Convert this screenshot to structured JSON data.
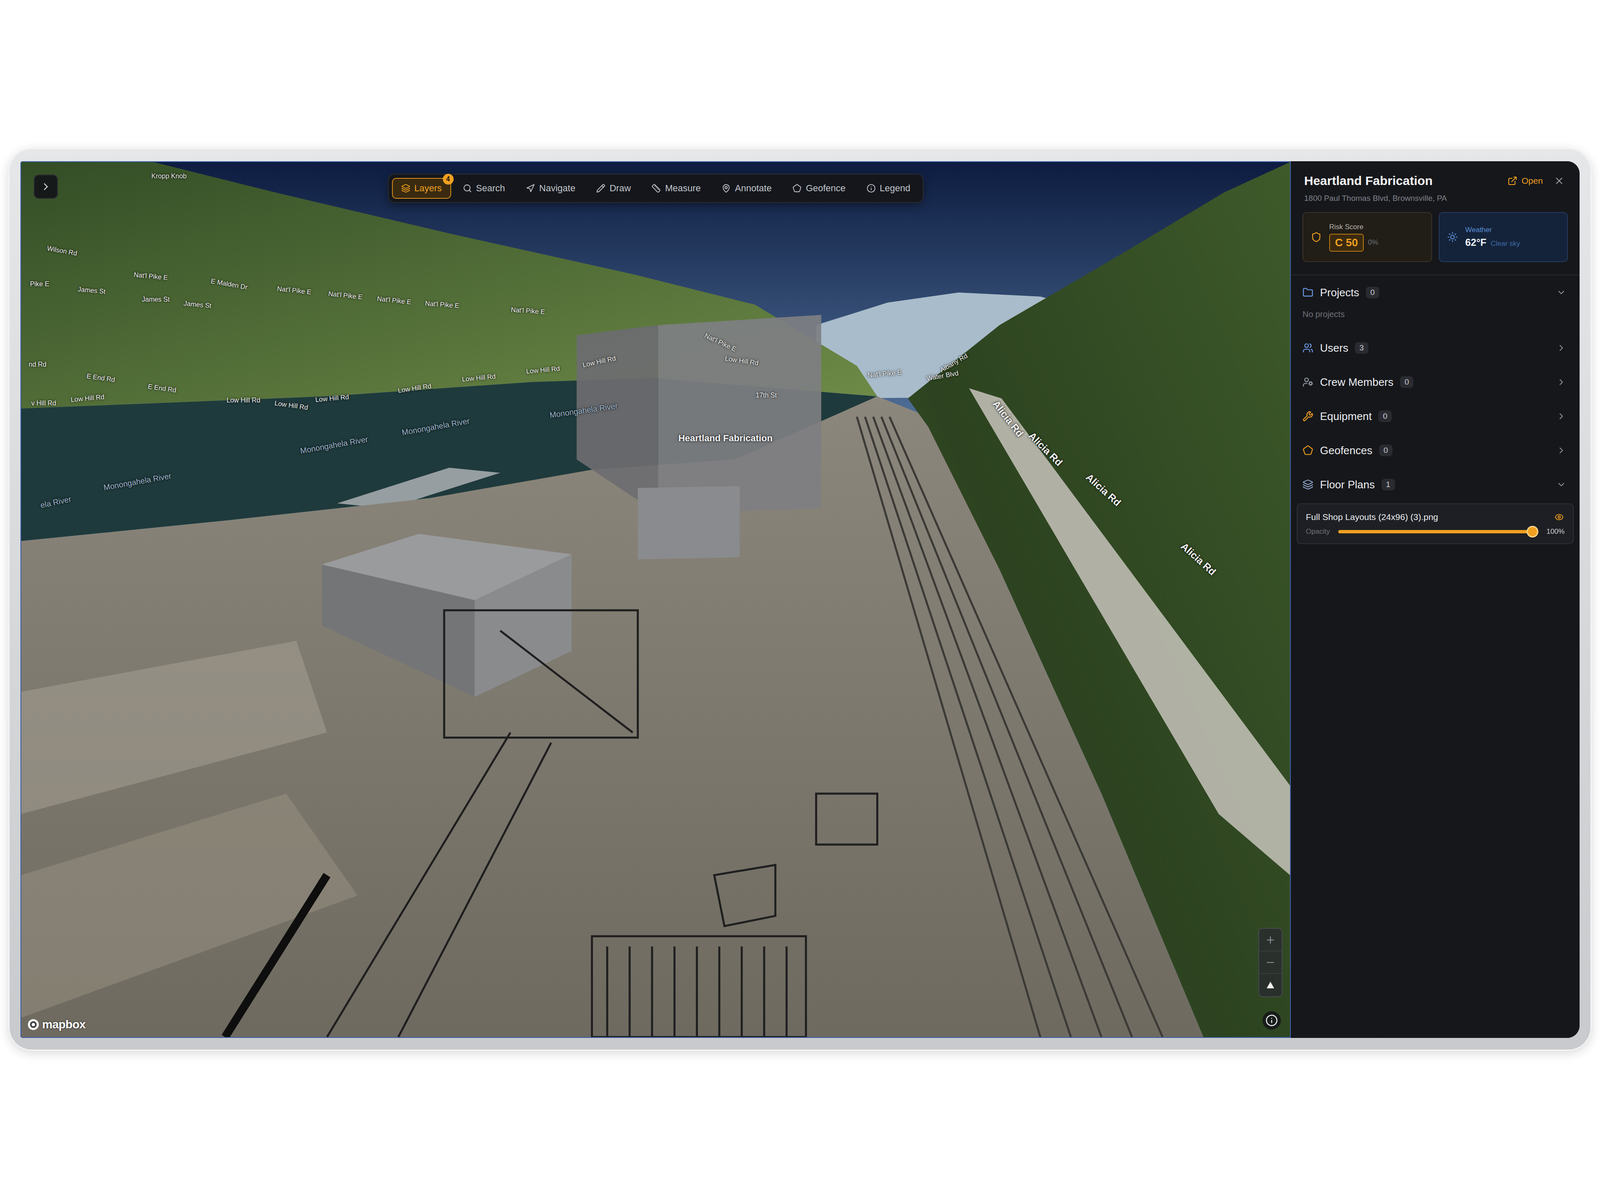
{
  "map": {
    "toolbar": [
      {
        "label": "Layers",
        "selected": true,
        "badge": "4"
      },
      {
        "label": "Search",
        "selected": false
      },
      {
        "label": "Navigate",
        "selected": false
      },
      {
        "label": "Draw",
        "selected": false
      },
      {
        "label": "Measure",
        "selected": false
      },
      {
        "label": "Annotate",
        "selected": false
      },
      {
        "label": "Geofence",
        "selected": false
      },
      {
        "label": "Legend",
        "selected": false
      }
    ],
    "labels": [
      {
        "text": "Heartland Fabrication",
        "kind": "place"
      },
      {
        "text": "Monongahela River",
        "kind": "water"
      },
      {
        "text": "Monongahela River",
        "kind": "water"
      },
      {
        "text": "Monongahela River",
        "kind": "water"
      },
      {
        "text": "Monongahela River",
        "kind": "water"
      },
      {
        "text": "ela River",
        "kind": "water"
      },
      {
        "text": "Alicia Rd",
        "kind": "major"
      },
      {
        "text": "Alicia Rd",
        "kind": "major"
      },
      {
        "text": "Alicia Rd",
        "kind": "major"
      },
      {
        "text": "Alicia Rd",
        "kind": "major"
      },
      {
        "text": "Nat'l Pike E",
        "kind": "road"
      },
      {
        "text": "Nat'l Pike E",
        "kind": "road"
      },
      {
        "text": "Nat'l Pike E",
        "kind": "road"
      },
      {
        "text": "Nat'l Pike E",
        "kind": "road"
      },
      {
        "text": "Nat'l Pike E",
        "kind": "road"
      },
      {
        "text": "Nat'l Pike E",
        "kind": "road"
      },
      {
        "text": "Nat'l Pike E",
        "kind": "road"
      },
      {
        "text": "Nat'l Pike E",
        "kind": "road"
      },
      {
        "text": "Low Hill Rd",
        "kind": "road"
      },
      {
        "text": "Low Hill Rd",
        "kind": "road"
      },
      {
        "text": "Low Hill Rd",
        "kind": "road"
      },
      {
        "text": "Low Hill Rd",
        "kind": "road"
      },
      {
        "text": "Low Hill Rd",
        "kind": "road"
      },
      {
        "text": "Low Hill Rd",
        "kind": "road"
      },
      {
        "text": "Low Hill Rd",
        "kind": "road"
      },
      {
        "text": "Low Hill Rd",
        "kind": "road"
      },
      {
        "text": "Low Hill Rd",
        "kind": "road"
      },
      {
        "text": "James St",
        "kind": "road"
      },
      {
        "text": "James St",
        "kind": "road"
      },
      {
        "text": "James St",
        "kind": "road"
      },
      {
        "text": "E Malden Dr",
        "kind": "road"
      },
      {
        "text": "E End Rd",
        "kind": "road"
      },
      {
        "text": "E End Rd",
        "kind": "road"
      },
      {
        "text": "17th St",
        "kind": "road"
      },
      {
        "text": "Water Blvd",
        "kind": "road"
      },
      {
        "text": "Albany Rd",
        "kind": "road"
      },
      {
        "text": "Kropp Knob",
        "kind": "area"
      },
      {
        "text": "Wilson Rd",
        "kind": "road"
      },
      {
        "text": "Pike E",
        "kind": "road"
      },
      {
        "text": "v Hill Rd",
        "kind": "road"
      },
      {
        "text": "nd Rd",
        "kind": "road"
      }
    ],
    "attribution": "mapbox"
  },
  "panel": {
    "title": "Heartland Fabrication",
    "address": "1800 Paul Thomas Blvd, Brownsville, PA",
    "open_label": "Open",
    "risk": {
      "label": "Risk Score",
      "grade": "C 50",
      "change": "0%"
    },
    "weather": {
      "label": "Weather",
      "temperature": "62°F",
      "condition": "Clear sky"
    },
    "sections": [
      {
        "label": "Projects",
        "count": "0",
        "expanded": true,
        "empty_text": "No projects",
        "items": []
      },
      {
        "label": "Users",
        "count": "3",
        "expanded": false,
        "items": []
      },
      {
        "label": "Crew Members",
        "count": "0",
        "expanded": false,
        "items": []
      },
      {
        "label": "Equipment",
        "count": "0",
        "expanded": false,
        "items": []
      },
      {
        "label": "Geofences",
        "count": "0",
        "expanded": false,
        "items": []
      },
      {
        "label": "Floor Plans",
        "count": "1",
        "expanded": true,
        "items": [
          {
            "name": "Full Shop Layouts (24x96) (3).png",
            "visible": true,
            "opacity_label": "Opacity",
            "level": 1,
            "reading": "100%"
          }
        ]
      }
    ]
  }
}
